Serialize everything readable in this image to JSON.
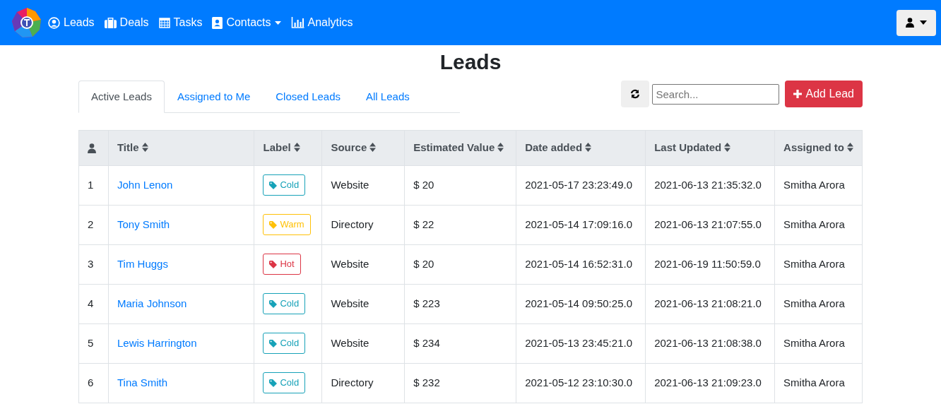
{
  "navbar": {
    "items": [
      {
        "label": "Leads",
        "dropdown": false
      },
      {
        "label": "Deals",
        "dropdown": false
      },
      {
        "label": "Tasks",
        "dropdown": false
      },
      {
        "label": "Contacts",
        "dropdown": true
      },
      {
        "label": "Analytics",
        "dropdown": false
      }
    ]
  },
  "page_title": "Leads",
  "tabs": [
    {
      "label": "Active Leads",
      "selected": true
    },
    {
      "label": "Assigned to Me",
      "selected": false
    },
    {
      "label": "Closed Leads",
      "selected": false
    },
    {
      "label": "All Leads",
      "selected": false
    }
  ],
  "search": {
    "placeholder": "Search..."
  },
  "add_button": "Add Lead",
  "table": {
    "columns": [
      "Title",
      "Label",
      "Source",
      "Estimated Value",
      "Date added",
      "Last Updated",
      "Assigned to"
    ],
    "rows": [
      {
        "number": "1",
        "title": "John Lenon",
        "label": "Cold",
        "color": "#17a2b8",
        "source": "Website",
        "value": "$ 20",
        "date_added": "2021-05-17 23:23:49.0",
        "last_updated": "2021-06-13 21:35:32.0",
        "assigned_to": "Smitha Arora"
      },
      {
        "number": "2",
        "title": "Tony Smith",
        "label": "Warm",
        "color": "#ffc107",
        "source": "Directory",
        "value": "$ 22",
        "date_added": "2021-05-14 17:09:16.0",
        "last_updated": "2021-06-13 21:07:55.0",
        "assigned_to": "Smitha Arora"
      },
      {
        "number": "3",
        "title": "Tim Huggs",
        "label": "Hot",
        "color": "#dc3545",
        "source": "Website",
        "value": "$ 20",
        "date_added": "2021-05-14 16:52:31.0",
        "last_updated": "2021-06-19 11:50:59.0",
        "assigned_to": "Smitha Arora"
      },
      {
        "number": "4",
        "title": "Maria Johnson",
        "label": "Cold",
        "color": "#17a2b8",
        "source": "Website",
        "value": "$ 223",
        "date_added": "2021-05-14 09:50:25.0",
        "last_updated": "2021-06-13 21:08:21.0",
        "assigned_to": "Smitha Arora"
      },
      {
        "number": "5",
        "title": "Lewis Harrington",
        "label": "Cold",
        "color": "#17a2b8",
        "source": "Website",
        "value": "$ 234",
        "date_added": "2021-05-13 23:45:21.0",
        "last_updated": "2021-06-13 21:08:38.0",
        "assigned_to": "Smitha Arora"
      },
      {
        "number": "6",
        "title": "Tina Smith",
        "label": "Cold",
        "color": "#17a2b8",
        "source": "Directory",
        "value": "$ 232",
        "date_added": "2021-05-12 23:10:30.0",
        "last_updated": "2021-06-13 21:09:23.0",
        "assigned_to": "Smitha Arora"
      }
    ]
  }
}
